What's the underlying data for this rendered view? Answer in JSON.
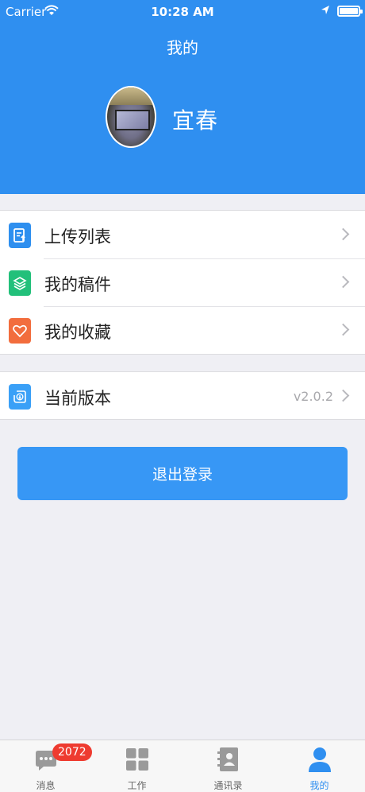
{
  "status_bar": {
    "carrier": "Carrier",
    "time": "10:28 AM"
  },
  "header": {
    "title": "我的",
    "username": "宜春"
  },
  "menu_group1": [
    {
      "label": "上传列表",
      "icon": "upload-list-icon",
      "color": "#2e8fef"
    },
    {
      "label": "我的稿件",
      "icon": "layers-icon",
      "color": "#22c07a"
    },
    {
      "label": "我的收藏",
      "icon": "heart-icon",
      "color": "#f26d3d"
    }
  ],
  "menu_group2": [
    {
      "label": "当前版本",
      "value": "v2.0.2",
      "icon": "version-icon",
      "color": "#3aa0f7"
    }
  ],
  "logout_label": "退出登录",
  "tabbar": {
    "badge": "2072",
    "tabs": [
      {
        "label": "消息",
        "icon": "chat-icon"
      },
      {
        "label": "工作",
        "icon": "grid-icon"
      },
      {
        "label": "通讯录",
        "icon": "contacts-icon"
      },
      {
        "label": "我的",
        "icon": "user-icon",
        "active": true
      }
    ]
  },
  "colors": {
    "brand": "#2f8ff0",
    "button": "#3797f5",
    "badge": "#ee3b30",
    "background": "#efeff4"
  }
}
